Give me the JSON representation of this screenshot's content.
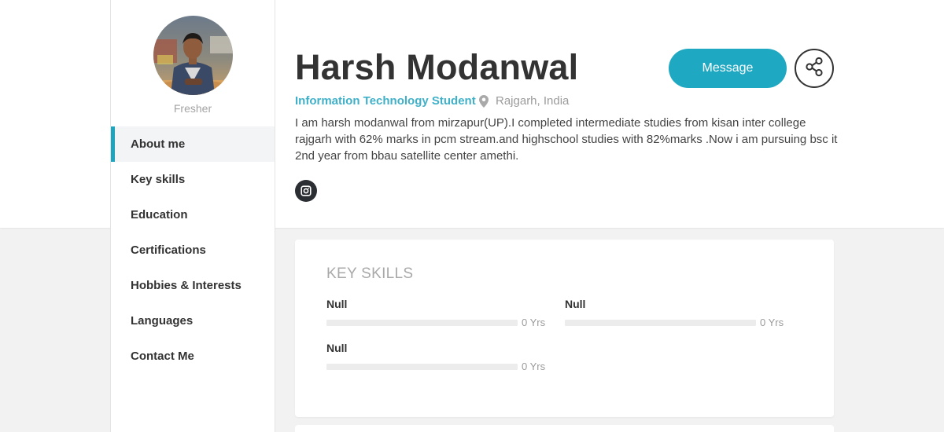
{
  "profile": {
    "name": "Harsh Modanwal",
    "role": "Information Technology Student",
    "location": "Rajgarh, India",
    "status": "Fresher",
    "bio": "I am harsh modanwal from mirzapur(UP).I completed intermediate studies from kisan inter college rajgarh with 62% marks in pcm stream.and highschool studies with 82%marks .Now i am pursuing bsc it 2nd year from bbau satellite center amethi."
  },
  "actions": {
    "message_label": "Message"
  },
  "nav": {
    "items": [
      {
        "label": "About me",
        "active": true
      },
      {
        "label": "Key skills"
      },
      {
        "label": "Education"
      },
      {
        "label": "Certifications"
      },
      {
        "label": "Hobbies & Interests"
      },
      {
        "label": "Languages"
      },
      {
        "label": "Contact Me"
      }
    ]
  },
  "key_skills": {
    "title": "KEY SKILLS",
    "skills": [
      {
        "name": "Null",
        "years": "0 Yrs",
        "level": 0
      },
      {
        "name": "Null",
        "years": "0 Yrs",
        "level": 0
      },
      {
        "name": "Null",
        "years": "0 Yrs",
        "level": 0
      }
    ]
  },
  "icons": {
    "location": "map-pin-icon",
    "social": "instagram-icon",
    "share": "share-icon"
  },
  "colors": {
    "accent": "#1fa8c2",
    "role_text": "#3fb0c8",
    "dark": "#333333"
  }
}
